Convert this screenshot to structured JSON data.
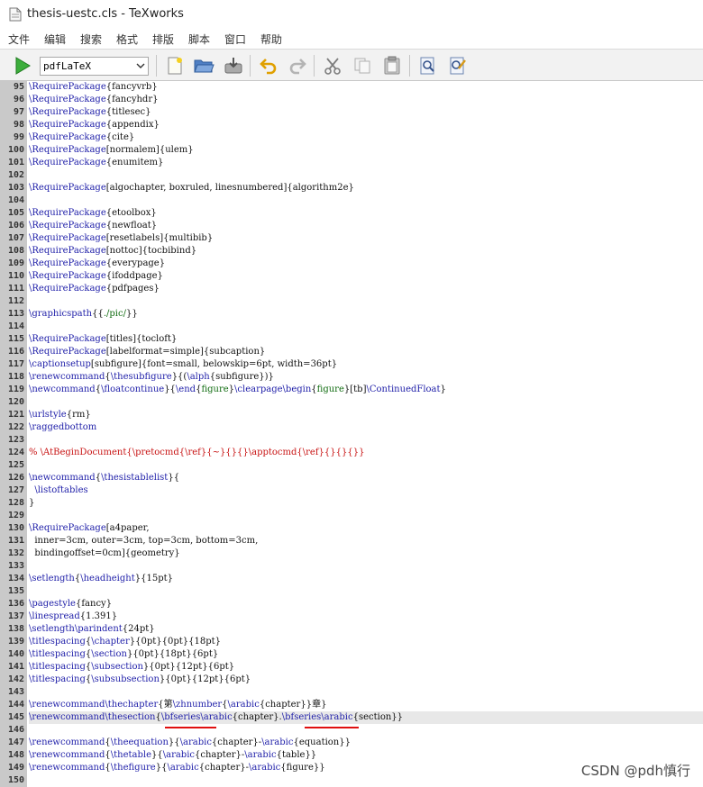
{
  "window": {
    "title": "thesis-uestc.cls - TeXworks",
    "icon": "document-icon"
  },
  "menu": {
    "items": [
      "文件",
      "编辑",
      "搜索",
      "格式",
      "排版",
      "脚本",
      "窗口",
      "帮助"
    ]
  },
  "toolbar": {
    "engine": "pdfLaTeX",
    "buttons": [
      {
        "name": "typeset-button",
        "icon": "play-icon"
      },
      {
        "name": "new-document-button",
        "icon": "new-file-icon"
      },
      {
        "name": "open-button",
        "icon": "folder-open-icon"
      },
      {
        "name": "save-button",
        "icon": "save-icon"
      },
      {
        "name": "undo-button",
        "icon": "undo-icon"
      },
      {
        "name": "redo-button",
        "icon": "redo-icon"
      },
      {
        "name": "cut-button",
        "icon": "scissors-icon"
      },
      {
        "name": "copy-button",
        "icon": "copy-icon"
      },
      {
        "name": "paste-button",
        "icon": "paste-icon"
      },
      {
        "name": "find-button",
        "icon": "find-icon"
      },
      {
        "name": "replace-button",
        "icon": "replace-icon"
      }
    ]
  },
  "editor": {
    "current_line": 145,
    "colors": {
      "command": "#1e1ea8",
      "argument": "#0f6b0f",
      "comment": "#c81414",
      "underline": "#e01010"
    },
    "lines": [
      {
        "n": 95,
        "tokens": [
          [
            "c",
            "\\RequirePackage"
          ],
          [
            "b",
            "{"
          ],
          [
            "t",
            "fancyvrb"
          ],
          [
            "b",
            "}"
          ]
        ]
      },
      {
        "n": 96,
        "tokens": [
          [
            "c",
            "\\RequirePackage"
          ],
          [
            "b",
            "{"
          ],
          [
            "t",
            "fancyhdr"
          ],
          [
            "b",
            "}"
          ]
        ]
      },
      {
        "n": 97,
        "tokens": [
          [
            "c",
            "\\RequirePackage"
          ],
          [
            "b",
            "{"
          ],
          [
            "t",
            "titlesec"
          ],
          [
            "b",
            "}"
          ]
        ]
      },
      {
        "n": 98,
        "tokens": [
          [
            "c",
            "\\RequirePackage"
          ],
          [
            "b",
            "{"
          ],
          [
            "t",
            "appendix"
          ],
          [
            "b",
            "}"
          ]
        ]
      },
      {
        "n": 99,
        "tokens": [
          [
            "c",
            "\\RequirePackage"
          ],
          [
            "b",
            "{"
          ],
          [
            "t",
            "cite"
          ],
          [
            "b",
            "}"
          ]
        ]
      },
      {
        "n": 100,
        "tokens": [
          [
            "c",
            "\\RequirePackage"
          ],
          [
            "t",
            "[normalem]{ulem}"
          ]
        ]
      },
      {
        "n": 101,
        "tokens": [
          [
            "c",
            "\\RequirePackage"
          ],
          [
            "b",
            "{"
          ],
          [
            "t",
            "enumitem"
          ],
          [
            "b",
            "}"
          ]
        ]
      },
      {
        "n": 102,
        "tokens": []
      },
      {
        "n": 103,
        "tokens": [
          [
            "c",
            "\\RequirePackage"
          ],
          [
            "t",
            "[algochapter, boxruled, linesnumbered]{algorithm2e}"
          ]
        ]
      },
      {
        "n": 104,
        "tokens": []
      },
      {
        "n": 105,
        "tokens": [
          [
            "c",
            "\\RequirePackage"
          ],
          [
            "b",
            "{"
          ],
          [
            "t",
            "etoolbox"
          ],
          [
            "b",
            "}"
          ]
        ]
      },
      {
        "n": 106,
        "tokens": [
          [
            "c",
            "\\RequirePackage"
          ],
          [
            "b",
            "{"
          ],
          [
            "t",
            "newfloat"
          ],
          [
            "b",
            "}"
          ]
        ]
      },
      {
        "n": 107,
        "tokens": [
          [
            "c",
            "\\RequirePackage"
          ],
          [
            "t",
            "[resetlabels]{multibib}"
          ]
        ]
      },
      {
        "n": 108,
        "tokens": [
          [
            "c",
            "\\RequirePackage"
          ],
          [
            "t",
            "[nottoc]{tocbibind}"
          ]
        ]
      },
      {
        "n": 109,
        "tokens": [
          [
            "c",
            "\\RequirePackage"
          ],
          [
            "b",
            "{"
          ],
          [
            "t",
            "everypage"
          ],
          [
            "b",
            "}"
          ]
        ]
      },
      {
        "n": 110,
        "tokens": [
          [
            "c",
            "\\RequirePackage"
          ],
          [
            "b",
            "{"
          ],
          [
            "t",
            "ifoddpage"
          ],
          [
            "b",
            "}"
          ]
        ]
      },
      {
        "n": 111,
        "tokens": [
          [
            "c",
            "\\RequirePackage"
          ],
          [
            "b",
            "{"
          ],
          [
            "t",
            "pdfpages"
          ],
          [
            "b",
            "}"
          ]
        ]
      },
      {
        "n": 112,
        "tokens": []
      },
      {
        "n": 113,
        "tokens": [
          [
            "c",
            "\\graphicspath"
          ],
          [
            "b",
            "{{"
          ],
          [
            "a",
            "./pic/"
          ],
          [
            "b",
            "}}"
          ]
        ]
      },
      {
        "n": 114,
        "tokens": []
      },
      {
        "n": 115,
        "tokens": [
          [
            "c",
            "\\RequirePackage"
          ],
          [
            "t",
            "[titles]{tocloft}"
          ]
        ]
      },
      {
        "n": 116,
        "tokens": [
          [
            "c",
            "\\RequirePackage"
          ],
          [
            "t",
            "[labelformat=simple]{subcaption}"
          ]
        ]
      },
      {
        "n": 117,
        "tokens": [
          [
            "c",
            "\\captionsetup"
          ],
          [
            "t",
            "[subfigure]{font=small, belowskip=6pt, width=36pt}"
          ]
        ]
      },
      {
        "n": 118,
        "tokens": [
          [
            "c",
            "\\renewcommand"
          ],
          [
            "b",
            "{"
          ],
          [
            "c",
            "\\thesubfigure"
          ],
          [
            "b",
            "}{("
          ],
          [
            "c",
            "\\alph"
          ],
          [
            "b",
            "{"
          ],
          [
            "t",
            "subfigure"
          ],
          [
            "b",
            "})}"
          ]
        ]
      },
      {
        "n": 119,
        "tokens": [
          [
            "c",
            "\\newcommand"
          ],
          [
            "b",
            "{"
          ],
          [
            "c",
            "\\floatcontinue"
          ],
          [
            "b",
            "}{"
          ],
          [
            "c",
            "\\end"
          ],
          [
            "b",
            "{"
          ],
          [
            "a",
            "figure"
          ],
          [
            "b",
            "}"
          ],
          [
            "c",
            "\\clearpage"
          ],
          [
            "c",
            "\\begin"
          ],
          [
            "b",
            "{"
          ],
          [
            "a",
            "figure"
          ],
          [
            "b",
            "}"
          ],
          [
            "t",
            "[tb]"
          ],
          [
            "c",
            "\\ContinuedFloat"
          ],
          [
            "b",
            "}"
          ]
        ]
      },
      {
        "n": 120,
        "tokens": []
      },
      {
        "n": 121,
        "tokens": [
          [
            "c",
            "\\urlstyle"
          ],
          [
            "b",
            "{"
          ],
          [
            "t",
            "rm"
          ],
          [
            "b",
            "}"
          ]
        ]
      },
      {
        "n": 122,
        "tokens": [
          [
            "c",
            "\\raggedbottom"
          ]
        ]
      },
      {
        "n": 123,
        "tokens": []
      },
      {
        "n": 124,
        "tokens": [
          [
            "m",
            "% \\AtBeginDocument{\\pretocmd{\\ref}{~}{}{}\\apptocmd{\\ref}{}{}{}}"
          ]
        ]
      },
      {
        "n": 125,
        "tokens": []
      },
      {
        "n": 126,
        "tokens": [
          [
            "c",
            "\\newcommand"
          ],
          [
            "b",
            "{"
          ],
          [
            "c",
            "\\thesistablelist"
          ],
          [
            "b",
            "}{"
          ]
        ]
      },
      {
        "n": 127,
        "tokens": [
          [
            "t",
            "  "
          ],
          [
            "c",
            "\\listoftables"
          ]
        ]
      },
      {
        "n": 128,
        "tokens": [
          [
            "b",
            "}"
          ]
        ]
      },
      {
        "n": 129,
        "tokens": []
      },
      {
        "n": 130,
        "tokens": [
          [
            "c",
            "\\RequirePackage"
          ],
          [
            "t",
            "[a4paper,"
          ]
        ]
      },
      {
        "n": 131,
        "tokens": [
          [
            "t",
            "  inner=3cm, outer=3cm, top=3cm, bottom=3cm,"
          ]
        ]
      },
      {
        "n": 132,
        "tokens": [
          [
            "t",
            "  bindingoffset=0cm]{geometry}"
          ]
        ]
      },
      {
        "n": 133,
        "tokens": []
      },
      {
        "n": 134,
        "tokens": [
          [
            "c",
            "\\setlength"
          ],
          [
            "b",
            "{"
          ],
          [
            "c",
            "\\headheight"
          ],
          [
            "b",
            "}"
          ],
          [
            "t",
            "{15pt}"
          ]
        ]
      },
      {
        "n": 135,
        "tokens": []
      },
      {
        "n": 136,
        "tokens": [
          [
            "c",
            "\\pagestyle"
          ],
          [
            "b",
            "{"
          ],
          [
            "t",
            "fancy"
          ],
          [
            "b",
            "}"
          ]
        ]
      },
      {
        "n": 137,
        "tokens": [
          [
            "c",
            "\\linespread"
          ],
          [
            "t",
            "{1.391}"
          ]
        ]
      },
      {
        "n": 138,
        "tokens": [
          [
            "c",
            "\\setlength"
          ],
          [
            "c",
            "\\parindent"
          ],
          [
            "t",
            "{24pt}"
          ]
        ]
      },
      {
        "n": 139,
        "tokens": [
          [
            "c",
            "\\titlespacing"
          ],
          [
            "b",
            "{"
          ],
          [
            "c",
            "\\chapter"
          ],
          [
            "b",
            "}"
          ],
          [
            "t",
            "{0pt}{0pt}{18pt}"
          ]
        ]
      },
      {
        "n": 140,
        "tokens": [
          [
            "c",
            "\\titlespacing"
          ],
          [
            "b",
            "{"
          ],
          [
            "c",
            "\\section"
          ],
          [
            "b",
            "}"
          ],
          [
            "t",
            "{0pt}{18pt}{6pt}"
          ]
        ]
      },
      {
        "n": 141,
        "tokens": [
          [
            "c",
            "\\titlespacing"
          ],
          [
            "b",
            "{"
          ],
          [
            "c",
            "\\subsection"
          ],
          [
            "b",
            "}"
          ],
          [
            "t",
            "{0pt}{12pt}{6pt}"
          ]
        ]
      },
      {
        "n": 142,
        "tokens": [
          [
            "c",
            "\\titlespacing"
          ],
          [
            "b",
            "{"
          ],
          [
            "c",
            "\\subsubsection"
          ],
          [
            "b",
            "}"
          ],
          [
            "t",
            "{0pt}{12pt}{6pt}"
          ]
        ]
      },
      {
        "n": 143,
        "tokens": []
      },
      {
        "n": 144,
        "tokens": [
          [
            "c",
            "\\renewcommand\\thechapter"
          ],
          [
            "b",
            "{"
          ],
          [
            "t",
            "第"
          ],
          [
            "c",
            "\\zhnumber"
          ],
          [
            "b",
            "{"
          ],
          [
            "c",
            "\\arabic"
          ],
          [
            "b",
            "{"
          ],
          [
            "t",
            "chapter"
          ],
          [
            "b",
            "}}"
          ],
          [
            "t",
            "章"
          ],
          [
            "b",
            "}"
          ]
        ]
      },
      {
        "n": 145,
        "tokens": [
          [
            "c",
            "\\renewcommand\\thesection"
          ],
          [
            "b",
            "{"
          ],
          [
            "c",
            "\\bfseries"
          ],
          [
            "c",
            "\\arabic"
          ],
          [
            "b",
            "{"
          ],
          [
            "t",
            "chapter"
          ],
          [
            "b",
            "}"
          ],
          [
            "t",
            "."
          ],
          [
            "c",
            "\\bfseries"
          ],
          [
            "c",
            "\\arabic"
          ],
          [
            "b",
            "{"
          ],
          [
            "t",
            "section"
          ],
          [
            "b",
            "}}"
          ]
        ]
      },
      {
        "n": 146,
        "tokens": []
      },
      {
        "n": 147,
        "tokens": [
          [
            "c",
            "\\renewcommand"
          ],
          [
            "b",
            "{"
          ],
          [
            "c",
            "\\theequation"
          ],
          [
            "b",
            "}{"
          ],
          [
            "c",
            "\\arabic"
          ],
          [
            "b",
            "{"
          ],
          [
            "t",
            "chapter"
          ],
          [
            "b",
            "}"
          ],
          [
            "t",
            "-"
          ],
          [
            "c",
            "\\arabic"
          ],
          [
            "b",
            "{"
          ],
          [
            "t",
            "equation"
          ],
          [
            "b",
            "}}"
          ]
        ]
      },
      {
        "n": 148,
        "tokens": [
          [
            "c",
            "\\renewcommand"
          ],
          [
            "b",
            "{"
          ],
          [
            "c",
            "\\thetable"
          ],
          [
            "b",
            "}{"
          ],
          [
            "c",
            "\\arabic"
          ],
          [
            "b",
            "{"
          ],
          [
            "t",
            "chapter"
          ],
          [
            "b",
            "}"
          ],
          [
            "t",
            "-"
          ],
          [
            "c",
            "\\arabic"
          ],
          [
            "b",
            "{"
          ],
          [
            "t",
            "table"
          ],
          [
            "b",
            "}}"
          ]
        ]
      },
      {
        "n": 149,
        "tokens": [
          [
            "c",
            "\\renewcommand"
          ],
          [
            "b",
            "{"
          ],
          [
            "c",
            "\\thefigure"
          ],
          [
            "b",
            "}{"
          ],
          [
            "c",
            "\\arabic"
          ],
          [
            "b",
            "{"
          ],
          [
            "t",
            "chapter"
          ],
          [
            "b",
            "}"
          ],
          [
            "t",
            "-"
          ],
          [
            "c",
            "\\arabic"
          ],
          [
            "b",
            "{"
          ],
          [
            "t",
            "figure"
          ],
          [
            "b",
            "}}"
          ]
        ]
      },
      {
        "n": 150,
        "tokens": []
      }
    ]
  },
  "watermark": "CSDN @pdh慎行"
}
